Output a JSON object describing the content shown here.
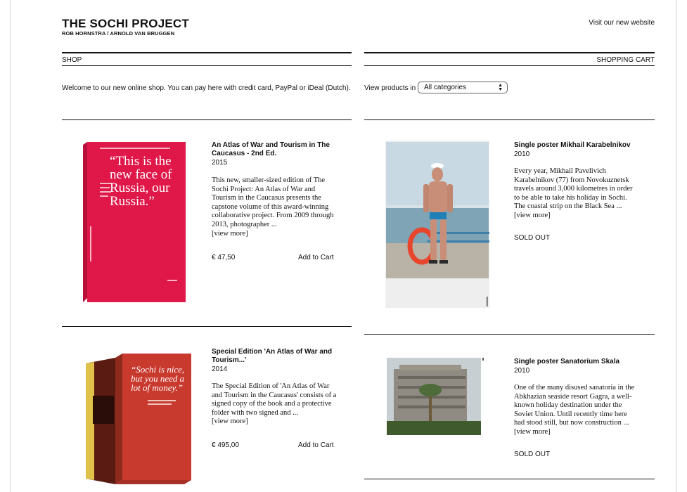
{
  "header": {
    "title": "THE SOCHI PROJECT",
    "subtitle": "ROB HORNSTRA / ARNOLD VAN BRUGGEN",
    "new_website_link": "Visit our new website"
  },
  "shop": {
    "label": "SHOP",
    "welcome": "Welcome to our new online shop. You can pay here with credit card, PayPal or iDeal (Dutch)."
  },
  "cart": {
    "label": "SHOPPING CART",
    "view_products_label": "View products in",
    "category_selected": "All categories"
  },
  "products": [
    {
      "title": "An Atlas of War and Tourism in The Caucasus - 2nd Ed.",
      "year": "2015",
      "description": "This new, smaller-sized edition of The Sochi Project: An Atlas of War and Tourism in the Caucasus presents the capstone volume of this award-winning collaborative project. From 2009 through 2013, photographer ...",
      "view_more": "[view more]",
      "price": "€ 47,50",
      "add_to_cart": "Add to Cart",
      "cover_quote": "“This is the new face of Russia, our Russia.”"
    },
    {
      "title": "Single poster Mikhail Karabelnikov",
      "year": "2010",
      "description": "Every year, Mikhail Pavelivich Karabelnikov (77) from Novokuznetsk travels around 3,000 kilometres in order to be able to take his holiday in Sochi. The coastal strip on the Black Sea ...",
      "view_more": "[view more]",
      "status": "SOLD OUT"
    },
    {
      "title": "Special Edition 'An Atlas of War and Tourism...'",
      "year": "2014",
      "description": "The Special Edition of 'An Atlas of War and Tourism in the Caucasus' consists of a signed copy of the book and a protective folder with two signed and ...",
      "view_more": "[view more]",
      "price": "€ 495,00",
      "add_to_cart": "Add to Cart",
      "cover_quote": "“Sochi is nice, but you need a lot of money.”"
    },
    {
      "title": "Single poster Sanatorium Skala",
      "year": "2010",
      "description": "One of the many disused sanatoria in the Abkhazian seaside resort Gagra, a well-known holiday destination under the Soviet Union. Until recently time here had stood still, but now construction ...",
      "view_more": "[view more]",
      "status": "SOLD OUT"
    }
  ],
  "colors": {
    "book_red": "#e0184a",
    "slipcase_red": "#c8392e",
    "text": "#111111"
  }
}
